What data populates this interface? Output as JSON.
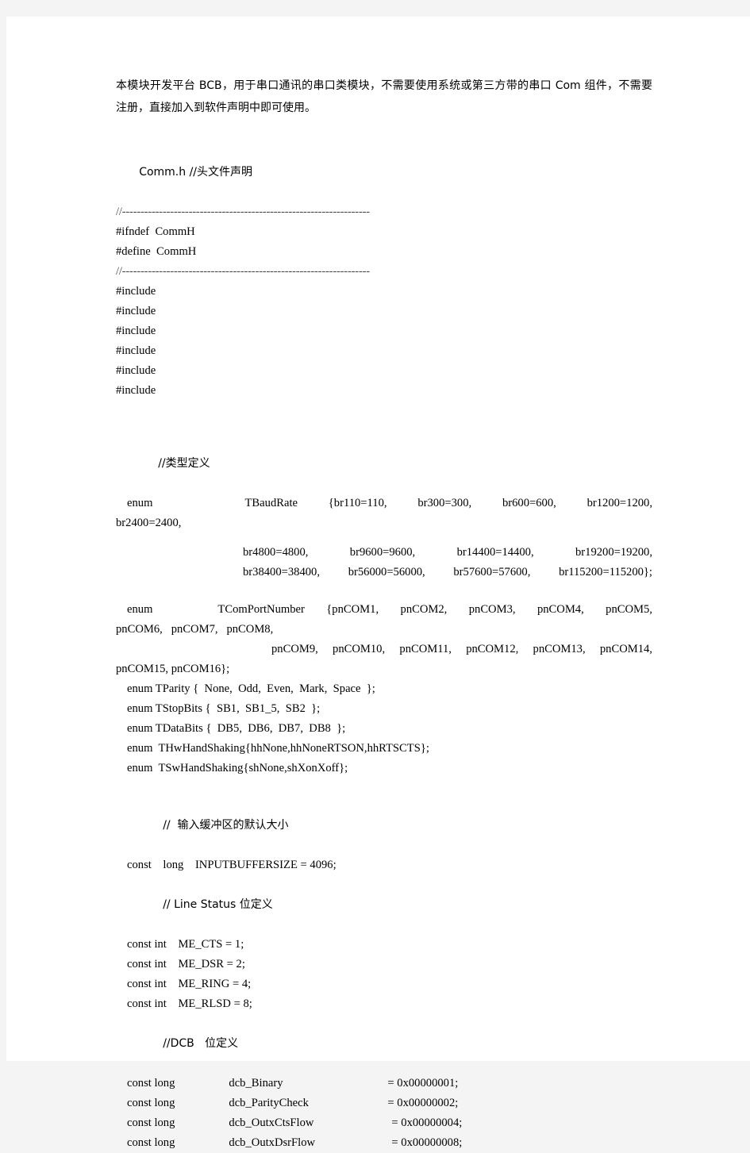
{
  "document": {
    "intro_paragraph": "本模块开发平台 BCB，用于串口通讯的串口类模块，不需要使用系统或第三方带的串口 Com 组件，不需要注册，直接加入到软件声明中即可使用。",
    "file_heading": "Comm.h //头文件声明",
    "rule_line": "//-------------------------------------------------------------------",
    "ifndef_line": "#ifndef  CommH",
    "define_line": "#define  CommH",
    "includes": [
      "#include",
      "#include",
      "#include",
      "#include",
      "#include",
      "#include"
    ],
    "type_def_comment": "//类型定义",
    "baudrate": {
      "decl": "enum   TBaudRate",
      "row1": [
        "{br110=110,",
        "br300=300,",
        "br600=600,",
        "br1200=1200,"
      ],
      "row1_cont": "br2400=2400,",
      "row2": [
        "br4800=4800,",
        "br9600=9600,",
        "br14400=14400,",
        "br19200=19200,"
      ],
      "row3": [
        "br38400=38400,",
        "br56000=56000,",
        "br57600=57600,",
        "br115200=115200};"
      ]
    },
    "comport": {
      "decl": "enum   TComPortNumber",
      "row1": [
        "{pnCOM1,",
        "pnCOM2,",
        "pnCOM3,",
        "pnCOM4,",
        "pnCOM5,"
      ],
      "row1_cont": "pnCOM6,   pnCOM7,   pnCOM8,",
      "row2": [
        "pnCOM9,",
        "pnCOM10,",
        "pnCOM11,",
        "pnCOM12,",
        "pnCOM13,",
        "pnCOM14,"
      ],
      "row2_cont": "pnCOM15, pnCOM16};"
    },
    "enums": [
      "enum TParity {  None,  Odd,  Even,  Mark,  Space  };",
      "enum TStopBits {  SB1,  SB1_5,  SB2  };",
      "enum TDataBits {  DB5,  DB6,  DB7,  DB8  };",
      "enum  THwHandShaking{hhNone,hhNoneRTSON,hhRTSCTS};",
      "enum  TSwHandShaking{shNone,shXonXoff};"
    ],
    "input_buffer_comment": "//  输入缓冲区的默认大小",
    "input_buffer_line": "const    long    INPUTBUFFERSIZE = 4096;",
    "line_status_comment": "// Line Status 位定义",
    "line_status_consts": [
      "const int    ME_CTS = 1;",
      "const int    ME_DSR = 2;",
      "const int    ME_RING = 4;",
      "const int    ME_RLSD = 8;"
    ],
    "dcb_comment": "//DCB   位定义",
    "dcb_consts": [
      {
        "decl": "const long",
        "name": "dcb_Binary",
        "value": "= 0x00000001;"
      },
      {
        "decl": "const long",
        "name": "dcb_ParityCheck",
        "value": "= 0x00000002;"
      },
      {
        "decl": "const long",
        "name": "dcb_OutxCtsFlow",
        "value": "= 0x00000004;"
      },
      {
        "decl": "const long",
        "name": "dcb_OutxDsrFlow",
        "value": "= 0x00000008;"
      }
    ]
  },
  "colors": {
    "page_background": "#ffffff",
    "canvas_background": "#f4f4f4",
    "text": "#000000",
    "rule": "#4a4a4a"
  }
}
